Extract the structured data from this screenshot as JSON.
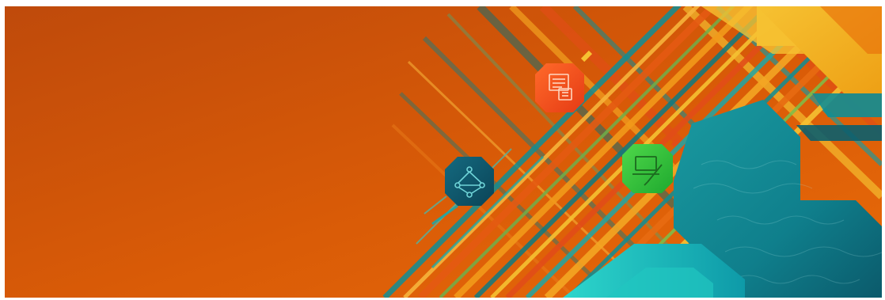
{
  "banner": {
    "colors": {
      "background_top": "#c8500a",
      "background_bottom": "#e36608",
      "teal": "#0f8e95",
      "teal_dark": "#0b5f6e",
      "cyan": "#21c6c0",
      "yellow": "#f2b01e",
      "green": "#35c43a",
      "red_orange": "#f04d1f",
      "navy_teal": "#0e4f63"
    },
    "icons": [
      {
        "name": "network-icon",
        "tile_color": "#0e5a70"
      },
      {
        "name": "document-stack-icon",
        "tile_color": "#f04d1f"
      },
      {
        "name": "laptop-edit-icon",
        "tile_color": "#2fc23c"
      }
    ]
  }
}
